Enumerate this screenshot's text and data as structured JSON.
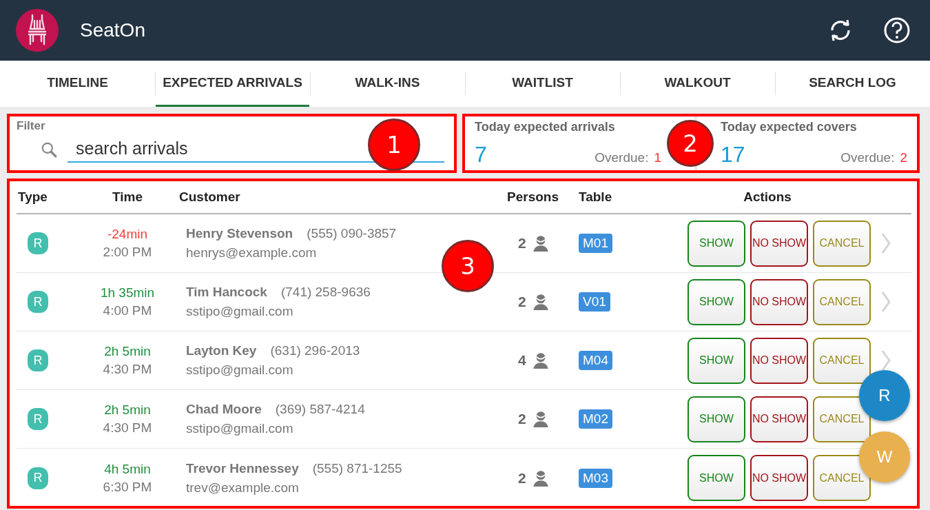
{
  "app": {
    "title": "SeatOn"
  },
  "tabs": [
    {
      "label": "TIMELINE",
      "selected": false
    },
    {
      "label": "EXPECTED ARRIVALS",
      "selected": true
    },
    {
      "label": "WALK-INS",
      "selected": false
    },
    {
      "label": "WAITLIST",
      "selected": false
    },
    {
      "label": "WALKOUT",
      "selected": false
    },
    {
      "label": "SEARCH LOG",
      "selected": false
    }
  ],
  "filter": {
    "label": "Filter",
    "placeholder": "search arrivals"
  },
  "stats": [
    {
      "label": "Today expected arrivals",
      "value": "7",
      "overdue_label": "Overdue:",
      "overdue": "1"
    },
    {
      "label": "Today expected covers",
      "value": "17",
      "overdue_label": "Overdue:",
      "overdue": "2"
    }
  ],
  "table": {
    "columns": [
      "Type",
      "Time",
      "Customer",
      "Persons",
      "Table",
      "Actions"
    ],
    "rows": [
      {
        "type": "R",
        "delta": "-24min",
        "overdue": true,
        "time": "2:00 PM",
        "name": "Henry Stevenson",
        "phone": "(555) 090-3857",
        "email": "henrys@example.com",
        "persons": "2",
        "table": "M01",
        "actions": [
          "SHOW",
          "NO SHOW",
          "CANCEL"
        ],
        "chevron": true
      },
      {
        "type": "R",
        "delta": "1h 35min",
        "overdue": false,
        "time": "4:00 PM",
        "name": "Tim Hancock",
        "phone": "(741) 258-9636",
        "email": "sstipo@gmail.com",
        "persons": "2",
        "table": "V01",
        "actions": [
          "SHOW",
          "NO SHOW",
          "CANCEL"
        ],
        "chevron": true
      },
      {
        "type": "R",
        "delta": "2h 5min",
        "overdue": false,
        "time": "4:30 PM",
        "name": "Layton Key",
        "phone": "(631) 296-2013",
        "email": "sstipo@gmail.com",
        "persons": "4",
        "table": "M04",
        "actions": [
          "SHOW",
          "NO SHOW",
          "CANCEL"
        ],
        "chevron": true
      },
      {
        "type": "R",
        "delta": "2h 5min",
        "overdue": false,
        "time": "4:30 PM",
        "name": "Chad Moore",
        "phone": "(369) 587-4214",
        "email": "sstipo@gmail.com",
        "persons": "2",
        "table": "M02",
        "actions": [
          "SHOW",
          "NO SHOW",
          "CANCEL"
        ],
        "chevron": false
      },
      {
        "type": "R",
        "delta": "4h 5min",
        "overdue": false,
        "time": "6:30 PM",
        "name": "Trevor Hennessey",
        "phone": "(555) 871-1255",
        "email": "trev@example.com",
        "persons": "2",
        "table": "M03",
        "actions": [
          "SHOW",
          "NO SHOW",
          "CANCEL"
        ],
        "chevron": false
      }
    ]
  },
  "fabs": [
    {
      "label": "R",
      "color": "#1e88c7"
    },
    {
      "label": "W",
      "color": "#e8b04e"
    }
  ],
  "callouts": [
    "1",
    "2",
    "3"
  ]
}
